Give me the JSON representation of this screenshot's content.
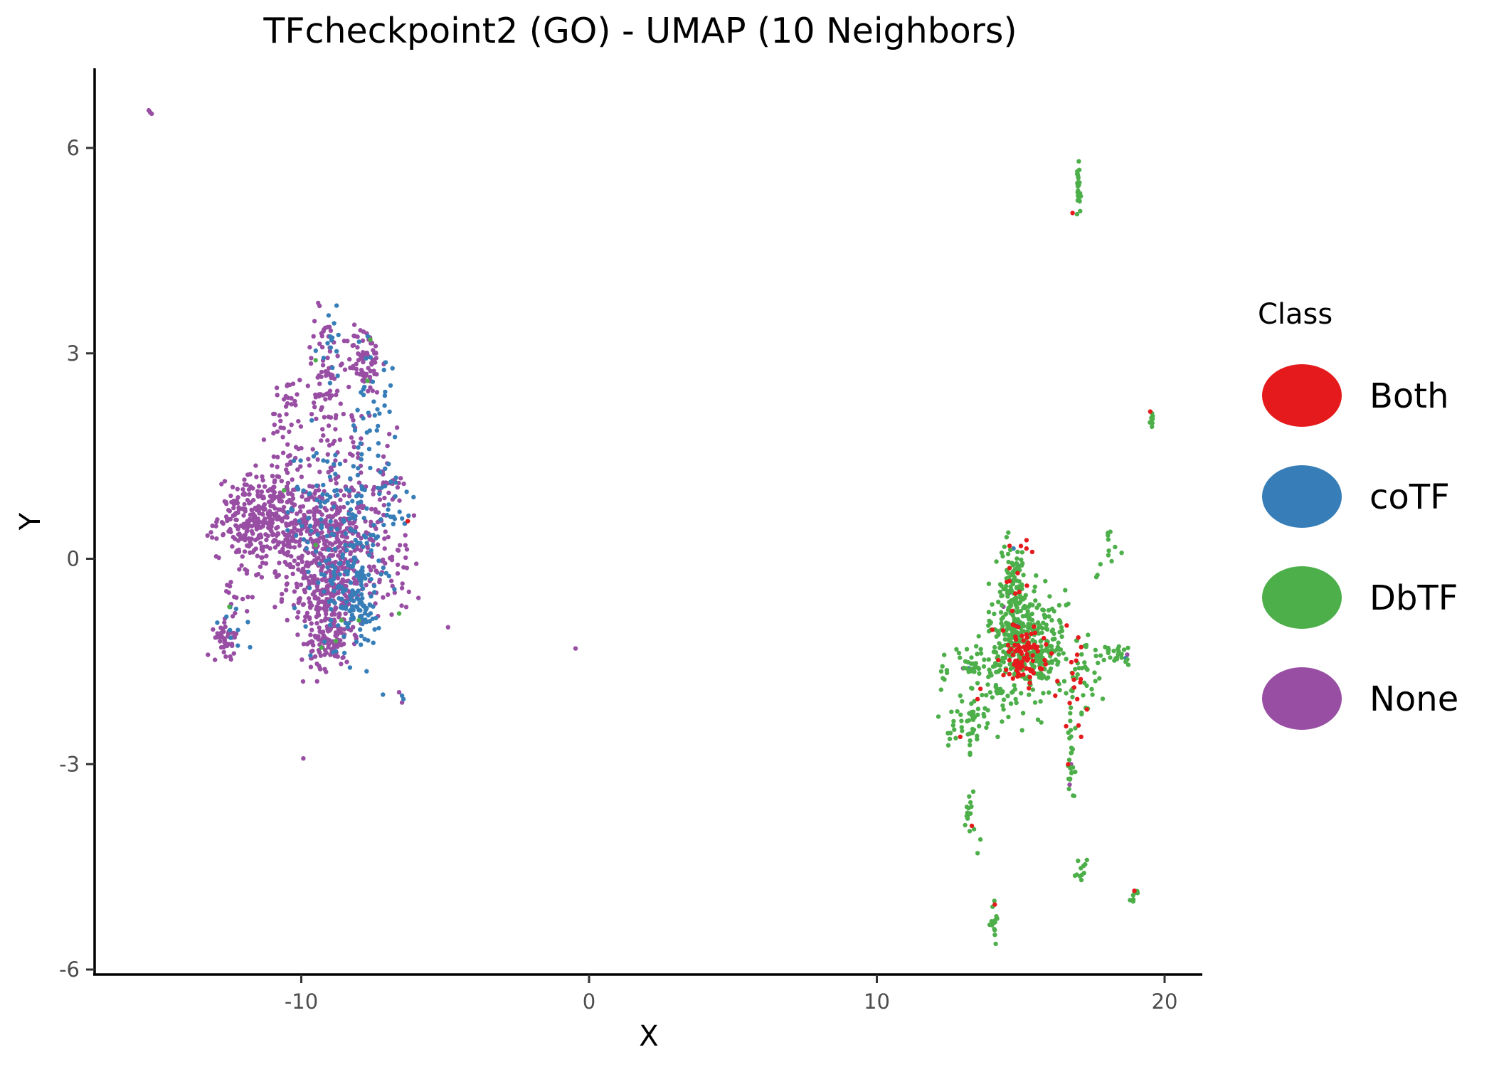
{
  "chart_data": {
    "type": "scatter",
    "title": "TFcheckpoint2 (GO) - UMAP (10 Neighbors)",
    "xlabel": "X",
    "ylabel": "Y",
    "xlim": [
      -17.2,
      21.3
    ],
    "ylim": [
      -6.07,
      7.16
    ],
    "xticks": [
      -10,
      0,
      10,
      20
    ],
    "xtick_labels": [
      "-10",
      "0",
      "10",
      "20"
    ],
    "yticks": [
      -6,
      -3,
      0,
      3,
      6
    ],
    "ytick_labels": [
      "-6",
      "-3",
      "0",
      "3",
      "6"
    ],
    "grid": false,
    "legend": {
      "title": "Class",
      "placement": "right",
      "entries": [
        {
          "name": "Both",
          "color": "#E41A1C"
        },
        {
          "name": "coTF",
          "color": "#377EB8"
        },
        {
          "name": "DbTF",
          "color": "#4DAF4A"
        },
        {
          "name": "None",
          "color": "#984EA3"
        }
      ]
    },
    "series": [
      {
        "name": "None",
        "color": "#984EA3",
        "clusters": [
          {
            "cx": -9.0,
            "cy": -0.4,
            "sx": 0.6,
            "sy": 0.6,
            "n": 380
          },
          {
            "cx": -11.5,
            "cy": 0.6,
            "sx": 0.7,
            "sy": 0.3,
            "n": 260
          },
          {
            "cx": -9.8,
            "cy": 0.5,
            "sx": 1.0,
            "sy": 0.35,
            "n": 220
          },
          {
            "cx": -7.5,
            "cy": 0.2,
            "sx": 0.5,
            "sy": 0.5,
            "n": 80
          },
          {
            "cx": -7.8,
            "cy": 2.9,
            "sx": 0.3,
            "sy": 0.25,
            "n": 80
          },
          {
            "cx": -9.2,
            "cy": 2.7,
            "sx": 0.35,
            "sy": 0.5,
            "n": 70
          },
          {
            "cx": -10.5,
            "cy": 1.8,
            "sx": 0.3,
            "sy": 0.45,
            "n": 50
          },
          {
            "cx": -8.6,
            "cy": 1.6,
            "sx": 0.7,
            "sy": 0.5,
            "n": 60
          },
          {
            "cx": -9.1,
            "cy": -1.2,
            "sx": 0.3,
            "sy": 0.2,
            "n": 60
          },
          {
            "cx": -12.6,
            "cy": -1.15,
            "sx": 0.2,
            "sy": 0.12,
            "n": 40
          },
          {
            "cx": -12.3,
            "cy": -0.5,
            "sx": 0.4,
            "sy": 0.4,
            "n": 25
          },
          {
            "cx": -7.0,
            "cy": 1.1,
            "sx": 0.25,
            "sy": 0.3,
            "n": 25
          },
          {
            "cx": -6.5,
            "cy": 0.0,
            "sx": 0.25,
            "sy": 0.45,
            "n": 20
          },
          {
            "cx": -10.7,
            "cy": 0.0,
            "sx": 0.5,
            "sy": 0.3,
            "n": 40
          }
        ],
        "points": [
          [
            -15.3,
            6.55
          ],
          [
            -15.2,
            6.5
          ],
          [
            -15.25,
            6.52
          ],
          [
            -4.9,
            -1.0
          ],
          [
            -0.47,
            -1.31
          ],
          [
            -6.5,
            -2.1
          ],
          [
            -6.6,
            -1.95
          ],
          [
            14.4,
            -0.7
          ],
          [
            13.0,
            -1.6
          ],
          [
            16.7,
            -3.3
          ],
          [
            16.75,
            -3.0
          ],
          [
            18.7,
            -1.4
          ],
          [
            14.6,
            -0.5
          ]
        ]
      },
      {
        "name": "coTF",
        "color": "#377EB8",
        "clusters": [
          {
            "cx": -8.2,
            "cy": -0.4,
            "sx": 0.5,
            "sy": 0.55,
            "n": 140
          },
          {
            "cx": -8.8,
            "cy": 0.6,
            "sx": 0.9,
            "sy": 0.6,
            "n": 110
          },
          {
            "cx": -7.6,
            "cy": 2.2,
            "sx": 0.4,
            "sy": 0.6,
            "n": 40
          },
          {
            "cx": -8.9,
            "cy": 3.1,
            "sx": 0.2,
            "sy": 0.25,
            "n": 15
          },
          {
            "cx": -7.9,
            "cy": -0.7,
            "sx": 0.15,
            "sy": 0.2,
            "n": 25
          },
          {
            "cx": -6.8,
            "cy": 0.8,
            "sx": 0.3,
            "sy": 0.3,
            "n": 20
          },
          {
            "cx": -12.3,
            "cy": -1.0,
            "sx": 0.3,
            "sy": 0.2,
            "n": 10
          }
        ],
        "points": [
          [
            -6.5,
            -2.0
          ],
          [
            -6.45,
            -2.05
          ],
          [
            -8.8,
            -1.35
          ],
          [
            -6.1,
            0.9
          ],
          [
            14.75,
            0.15
          ],
          [
            14.95,
            -0.95
          ],
          [
            13.2,
            -1.6
          ],
          [
            18.65,
            -1.45
          ],
          [
            14.9,
            -0.1
          ]
        ]
      },
      {
        "name": "DbTF",
        "color": "#4DAF4A",
        "clusters": [
          {
            "cx": 15.0,
            "cy": -1.2,
            "sx": 0.55,
            "sy": 0.45,
            "n": 300
          },
          {
            "cx": 14.7,
            "cy": -0.45,
            "sx": 0.3,
            "sy": 0.35,
            "n": 90
          },
          {
            "cx": 15.9,
            "cy": -1.4,
            "sx": 0.4,
            "sy": 0.2,
            "n": 50
          },
          {
            "cx": 17.2,
            "cy": -1.75,
            "sx": 0.25,
            "sy": 0.35,
            "n": 35
          },
          {
            "cx": 18.3,
            "cy": -1.4,
            "sx": 0.4,
            "sy": 0.08,
            "n": 30
          },
          {
            "cx": 13.1,
            "cy": -2.4,
            "sx": 0.3,
            "sy": 0.2,
            "n": 40
          },
          {
            "cx": 13.7,
            "cy": -2.0,
            "sx": 0.35,
            "sy": 0.25,
            "n": 25
          },
          {
            "cx": 13.3,
            "cy": -1.55,
            "sx": 0.35,
            "sy": 0.15,
            "n": 30
          },
          {
            "cx": 17.0,
            "cy": 5.4,
            "sx": 0.06,
            "sy": 0.2,
            "n": 30
          },
          {
            "cx": 16.75,
            "cy": -2.6,
            "sx": 0.08,
            "sy": 0.4,
            "n": 18
          },
          {
            "cx": 16.75,
            "cy": -3.2,
            "sx": 0.06,
            "sy": 0.15,
            "n": 10
          },
          {
            "cx": 13.2,
            "cy": -3.75,
            "sx": 0.07,
            "sy": 0.15,
            "n": 15
          },
          {
            "cx": 14.1,
            "cy": -5.25,
            "sx": 0.08,
            "sy": 0.15,
            "n": 14
          },
          {
            "cx": 17.1,
            "cy": -4.65,
            "sx": 0.07,
            "sy": 0.1,
            "n": 10
          },
          {
            "cx": 18.95,
            "cy": -4.9,
            "sx": 0.05,
            "sy": 0.05,
            "n": 8
          },
          {
            "cx": 19.55,
            "cy": 2.05,
            "sx": 0.05,
            "sy": 0.08,
            "n": 8
          },
          {
            "cx": 17.9,
            "cy": 0.05,
            "sx": 0.2,
            "sy": 0.2,
            "n": 12
          },
          {
            "cx": 12.3,
            "cy": -1.7,
            "sx": 0.08,
            "sy": 0.15,
            "n": 8
          },
          {
            "cx": 16.3,
            "cy": -1.1,
            "sx": 0.4,
            "sy": 0.3,
            "n": 25
          }
        ],
        "points": [
          [
            -9.5,
            0.2
          ],
          [
            -12.5,
            -0.7
          ],
          [
            -9.5,
            2.9
          ],
          [
            -7.7,
            2.6
          ],
          [
            -8.6,
            -0.9
          ],
          [
            -8.0,
            -0.9
          ],
          [
            -10.6,
            1.0
          ],
          [
            -7.6,
            3.2
          ],
          [
            -9.3,
            -1.3
          ],
          [
            -6.6,
            -0.8
          ],
          [
            -8.8,
            -1.2
          ],
          [
            13.6,
            -4.1
          ],
          [
            13.5,
            -4.3
          ],
          [
            13.35,
            -3.4
          ],
          [
            15.5,
            -2.1
          ],
          [
            15.6,
            -2.35
          ],
          [
            17.3,
            -4.4
          ],
          [
            12.9,
            -2.0
          ],
          [
            14.2,
            -2.6
          ]
        ]
      },
      {
        "name": "Both",
        "color": "#E41A1C",
        "clusters": [
          {
            "cx": 15.1,
            "cy": -1.4,
            "sx": 0.35,
            "sy": 0.2,
            "n": 80
          },
          {
            "cx": 14.9,
            "cy": -0.6,
            "sx": 0.4,
            "sy": 0.5,
            "n": 18
          },
          {
            "cx": 16.9,
            "cy": -1.7,
            "sx": 0.3,
            "sy": 0.4,
            "n": 16
          }
        ],
        "points": [
          [
            15.2,
            0.15
          ],
          [
            15.4,
            0.1
          ],
          [
            16.8,
            5.05
          ],
          [
            19.5,
            2.15
          ],
          [
            13.5,
            -2.05
          ],
          [
            13.6,
            -1.9
          ],
          [
            12.9,
            -2.6
          ],
          [
            16.65,
            -3.0
          ],
          [
            17.1,
            -2.6
          ],
          [
            17.3,
            -2.2
          ],
          [
            16.2,
            -2.0
          ],
          [
            14.1,
            -5.05
          ],
          [
            13.3,
            -3.9
          ],
          [
            18.95,
            -4.85
          ],
          [
            14.4,
            -1.7
          ],
          [
            17.0,
            -1.15
          ],
          [
            -6.3,
            0.55
          ]
        ]
      }
    ]
  }
}
